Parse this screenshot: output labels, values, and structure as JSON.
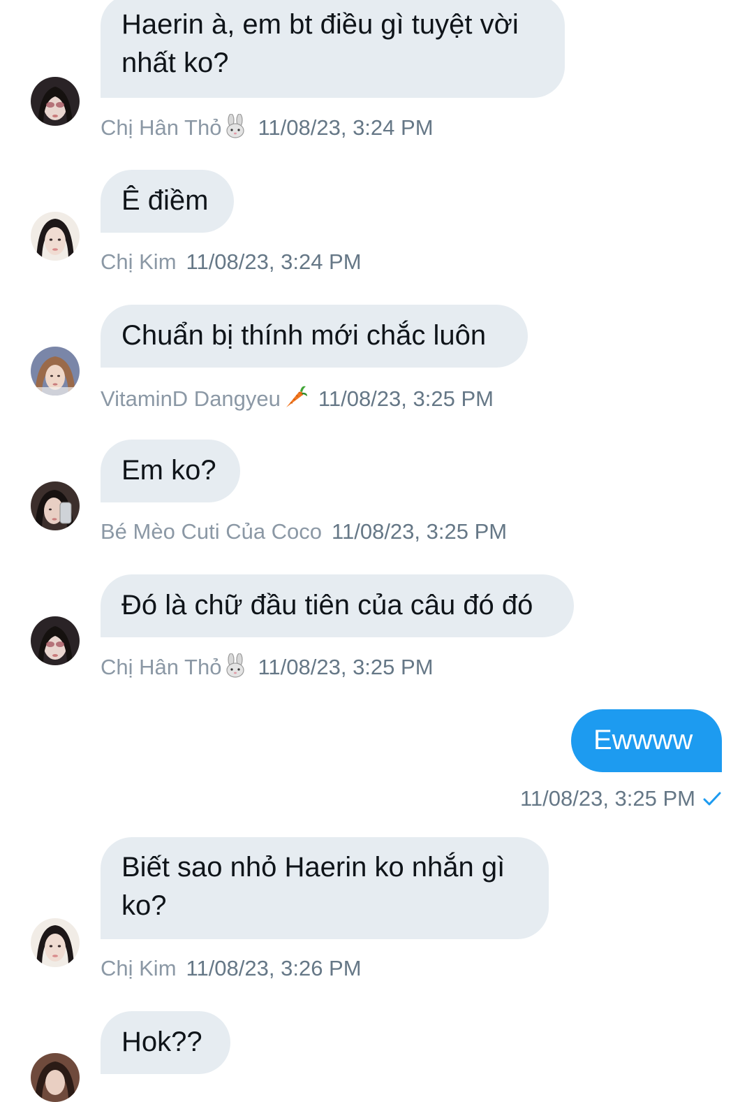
{
  "conversation": {
    "messages": [
      {
        "text": "Haerin à, em bt điều gì tuyệt vời\nnhất ko?",
        "sender": "Chị Hân Thỏ",
        "sender_emoji": "rabbit-face-icon",
        "time": "11/08/23, 3:24 PM"
      },
      {
        "text": "Ê điềm",
        "sender": "Chị Kim",
        "time": "11/08/23, 3:24 PM"
      },
      {
        "text": "Chuẩn bị thính mới chắc luôn",
        "sender": "VitaminD Dangyeu",
        "sender_emoji": "carrot-icon",
        "time": "11/08/23, 3:25 PM"
      },
      {
        "text": "Em ko?",
        "sender": "Bé Mèo Cuti Của Coco",
        "time": "11/08/23, 3:25 PM"
      },
      {
        "text": "Đó là chữ đầu tiên của câu đó đó",
        "sender": "Chị Hân Thỏ",
        "sender_emoji": "rabbit-face-icon",
        "time": "11/08/23, 3:25 PM"
      },
      {
        "own": true,
        "text": "Ewwww",
        "time": "11/08/23, 3:25 PM",
        "status_icon": "checkmark-icon"
      },
      {
        "text": "Biết sao nhỏ Haerin ko nhắn gì\nko?",
        "sender": "Chị Kim",
        "time": "11/08/23, 3:26 PM"
      },
      {
        "text": "Hok??"
      }
    ]
  },
  "colors": {
    "incoming_bubble": "#e6ecf1",
    "outgoing_bubble": "#1d9bf0",
    "meta_text": "#8b98a5",
    "check": "#1d9bf0"
  }
}
